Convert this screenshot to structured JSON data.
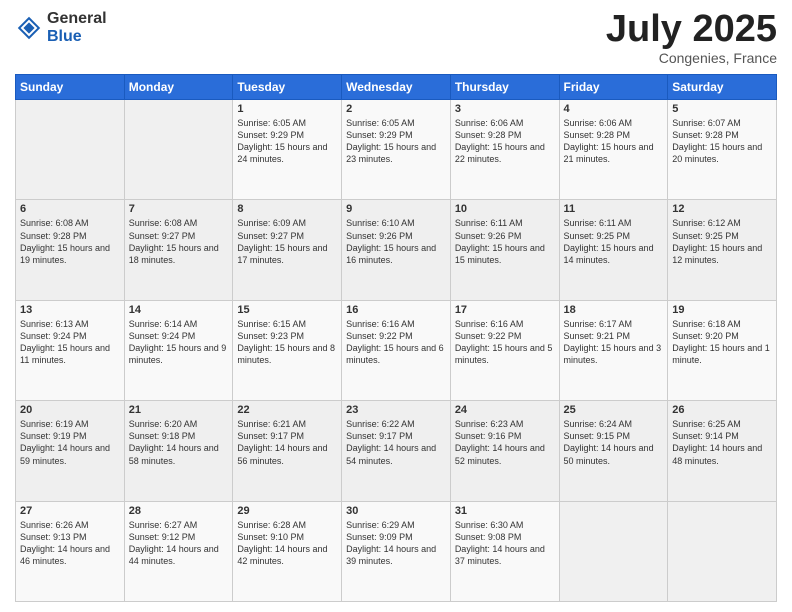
{
  "logo": {
    "general": "General",
    "blue": "Blue"
  },
  "header": {
    "month": "July 2025",
    "location": "Congenies, France"
  },
  "weekdays": [
    "Sunday",
    "Monday",
    "Tuesday",
    "Wednesday",
    "Thursday",
    "Friday",
    "Saturday"
  ],
  "weeks": [
    [
      {
        "day": "",
        "info": ""
      },
      {
        "day": "",
        "info": ""
      },
      {
        "day": "1",
        "info": "Sunrise: 6:05 AM\nSunset: 9:29 PM\nDaylight: 15 hours and 24 minutes."
      },
      {
        "day": "2",
        "info": "Sunrise: 6:05 AM\nSunset: 9:29 PM\nDaylight: 15 hours and 23 minutes."
      },
      {
        "day": "3",
        "info": "Sunrise: 6:06 AM\nSunset: 9:28 PM\nDaylight: 15 hours and 22 minutes."
      },
      {
        "day": "4",
        "info": "Sunrise: 6:06 AM\nSunset: 9:28 PM\nDaylight: 15 hours and 21 minutes."
      },
      {
        "day": "5",
        "info": "Sunrise: 6:07 AM\nSunset: 9:28 PM\nDaylight: 15 hours and 20 minutes."
      }
    ],
    [
      {
        "day": "6",
        "info": "Sunrise: 6:08 AM\nSunset: 9:28 PM\nDaylight: 15 hours and 19 minutes."
      },
      {
        "day": "7",
        "info": "Sunrise: 6:08 AM\nSunset: 9:27 PM\nDaylight: 15 hours and 18 minutes."
      },
      {
        "day": "8",
        "info": "Sunrise: 6:09 AM\nSunset: 9:27 PM\nDaylight: 15 hours and 17 minutes."
      },
      {
        "day": "9",
        "info": "Sunrise: 6:10 AM\nSunset: 9:26 PM\nDaylight: 15 hours and 16 minutes."
      },
      {
        "day": "10",
        "info": "Sunrise: 6:11 AM\nSunset: 9:26 PM\nDaylight: 15 hours and 15 minutes."
      },
      {
        "day": "11",
        "info": "Sunrise: 6:11 AM\nSunset: 9:25 PM\nDaylight: 15 hours and 14 minutes."
      },
      {
        "day": "12",
        "info": "Sunrise: 6:12 AM\nSunset: 9:25 PM\nDaylight: 15 hours and 12 minutes."
      }
    ],
    [
      {
        "day": "13",
        "info": "Sunrise: 6:13 AM\nSunset: 9:24 PM\nDaylight: 15 hours and 11 minutes."
      },
      {
        "day": "14",
        "info": "Sunrise: 6:14 AM\nSunset: 9:24 PM\nDaylight: 15 hours and 9 minutes."
      },
      {
        "day": "15",
        "info": "Sunrise: 6:15 AM\nSunset: 9:23 PM\nDaylight: 15 hours and 8 minutes."
      },
      {
        "day": "16",
        "info": "Sunrise: 6:16 AM\nSunset: 9:22 PM\nDaylight: 15 hours and 6 minutes."
      },
      {
        "day": "17",
        "info": "Sunrise: 6:16 AM\nSunset: 9:22 PM\nDaylight: 15 hours and 5 minutes."
      },
      {
        "day": "18",
        "info": "Sunrise: 6:17 AM\nSunset: 9:21 PM\nDaylight: 15 hours and 3 minutes."
      },
      {
        "day": "19",
        "info": "Sunrise: 6:18 AM\nSunset: 9:20 PM\nDaylight: 15 hours and 1 minute."
      }
    ],
    [
      {
        "day": "20",
        "info": "Sunrise: 6:19 AM\nSunset: 9:19 PM\nDaylight: 14 hours and 59 minutes."
      },
      {
        "day": "21",
        "info": "Sunrise: 6:20 AM\nSunset: 9:18 PM\nDaylight: 14 hours and 58 minutes."
      },
      {
        "day": "22",
        "info": "Sunrise: 6:21 AM\nSunset: 9:17 PM\nDaylight: 14 hours and 56 minutes."
      },
      {
        "day": "23",
        "info": "Sunrise: 6:22 AM\nSunset: 9:17 PM\nDaylight: 14 hours and 54 minutes."
      },
      {
        "day": "24",
        "info": "Sunrise: 6:23 AM\nSunset: 9:16 PM\nDaylight: 14 hours and 52 minutes."
      },
      {
        "day": "25",
        "info": "Sunrise: 6:24 AM\nSunset: 9:15 PM\nDaylight: 14 hours and 50 minutes."
      },
      {
        "day": "26",
        "info": "Sunrise: 6:25 AM\nSunset: 9:14 PM\nDaylight: 14 hours and 48 minutes."
      }
    ],
    [
      {
        "day": "27",
        "info": "Sunrise: 6:26 AM\nSunset: 9:13 PM\nDaylight: 14 hours and 46 minutes."
      },
      {
        "day": "28",
        "info": "Sunrise: 6:27 AM\nSunset: 9:12 PM\nDaylight: 14 hours and 44 minutes."
      },
      {
        "day": "29",
        "info": "Sunrise: 6:28 AM\nSunset: 9:10 PM\nDaylight: 14 hours and 42 minutes."
      },
      {
        "day": "30",
        "info": "Sunrise: 6:29 AM\nSunset: 9:09 PM\nDaylight: 14 hours and 39 minutes."
      },
      {
        "day": "31",
        "info": "Sunrise: 6:30 AM\nSunset: 9:08 PM\nDaylight: 14 hours and 37 minutes."
      },
      {
        "day": "",
        "info": ""
      },
      {
        "day": "",
        "info": ""
      }
    ]
  ]
}
